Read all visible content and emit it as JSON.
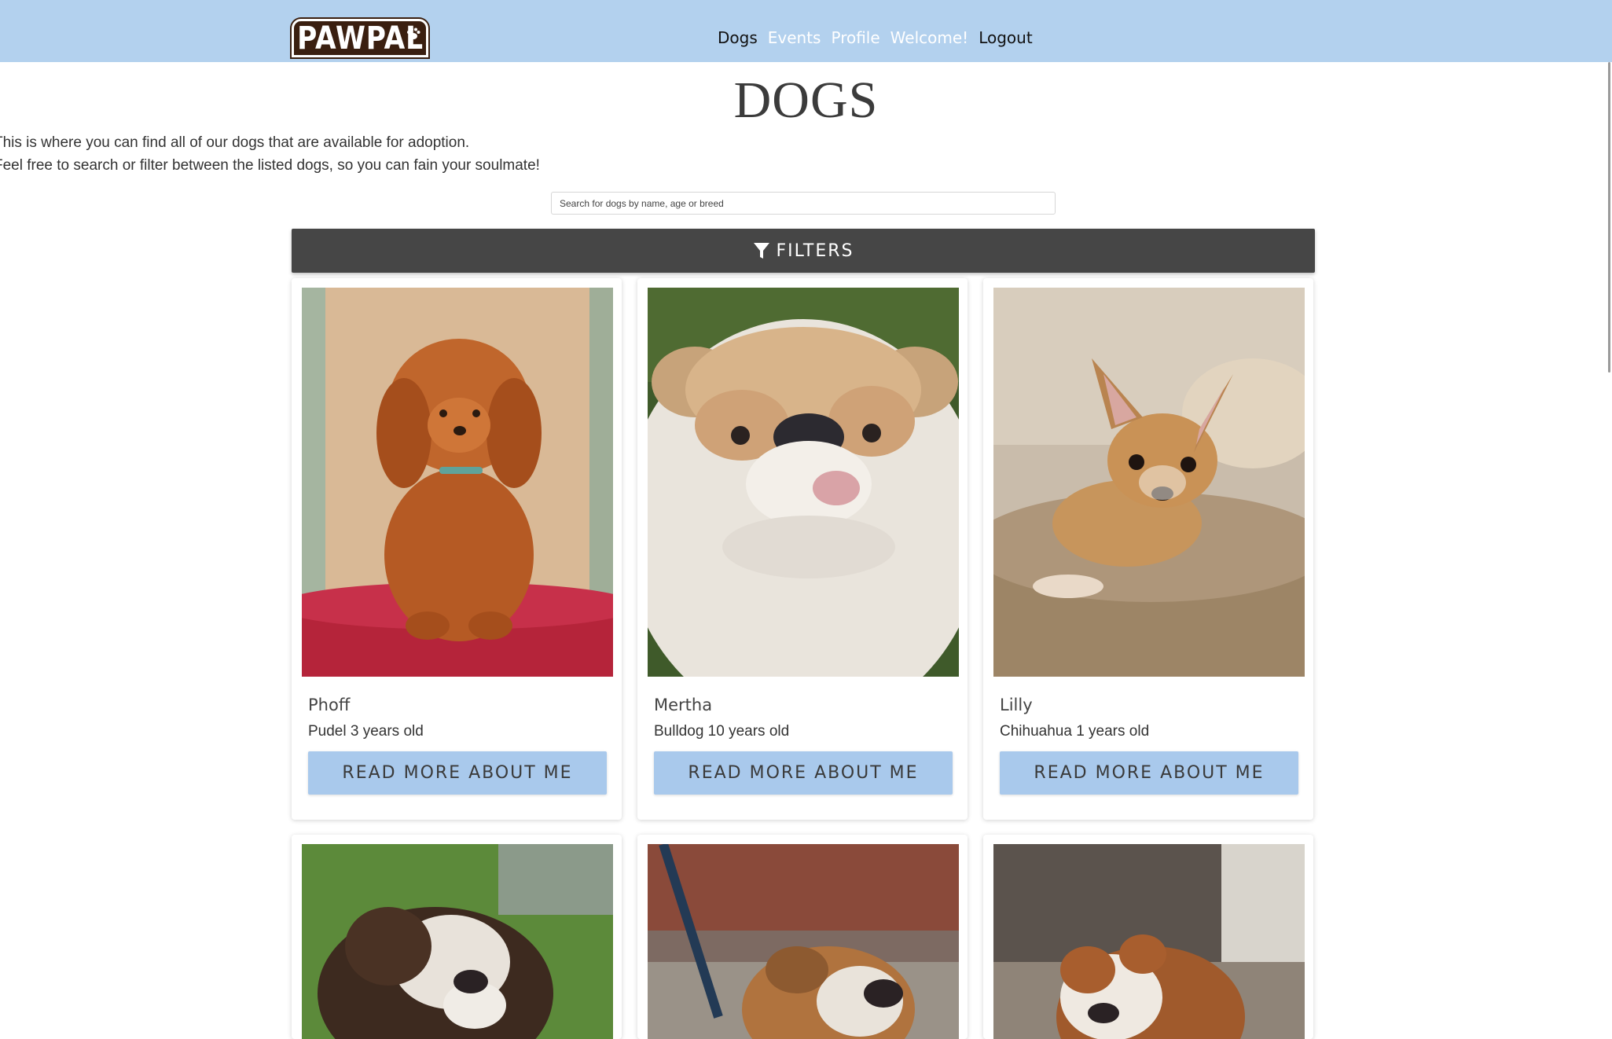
{
  "header": {
    "logo_text": "PAWPAL",
    "nav": [
      {
        "label": "Dogs"
      },
      {
        "label": "Events"
      },
      {
        "label": "Profile"
      },
      {
        "label": "Welcome!"
      },
      {
        "label": "Logout"
      }
    ]
  },
  "page": {
    "title": "DOGS",
    "intro_line1": "This is where you can find all of our dogs that are available for adoption.",
    "intro_line2": "Feel free to search or filter between the listed dogs, so you can fain your soulmate!"
  },
  "search": {
    "placeholder": "Search for dogs by name, age or breed"
  },
  "filters": {
    "label": "FILTERS",
    "icon": "filter-icon"
  },
  "dogs": [
    {
      "name": "Phoff",
      "details": "Pudel 3 years old",
      "button": "READ MORE ABOUT ME"
    },
    {
      "name": "Mertha",
      "details": "Bulldog 10 years old",
      "button": "READ MORE ABOUT ME"
    },
    {
      "name": "Lilly",
      "details": "Chihuahua 1 years old",
      "button": "READ MORE ABOUT ME"
    }
  ],
  "colors": {
    "header_bg": "#b3d1ee",
    "filters_bg": "#464646",
    "button_bg": "#a9c9ec",
    "logo_bg": "#3a1f10"
  }
}
